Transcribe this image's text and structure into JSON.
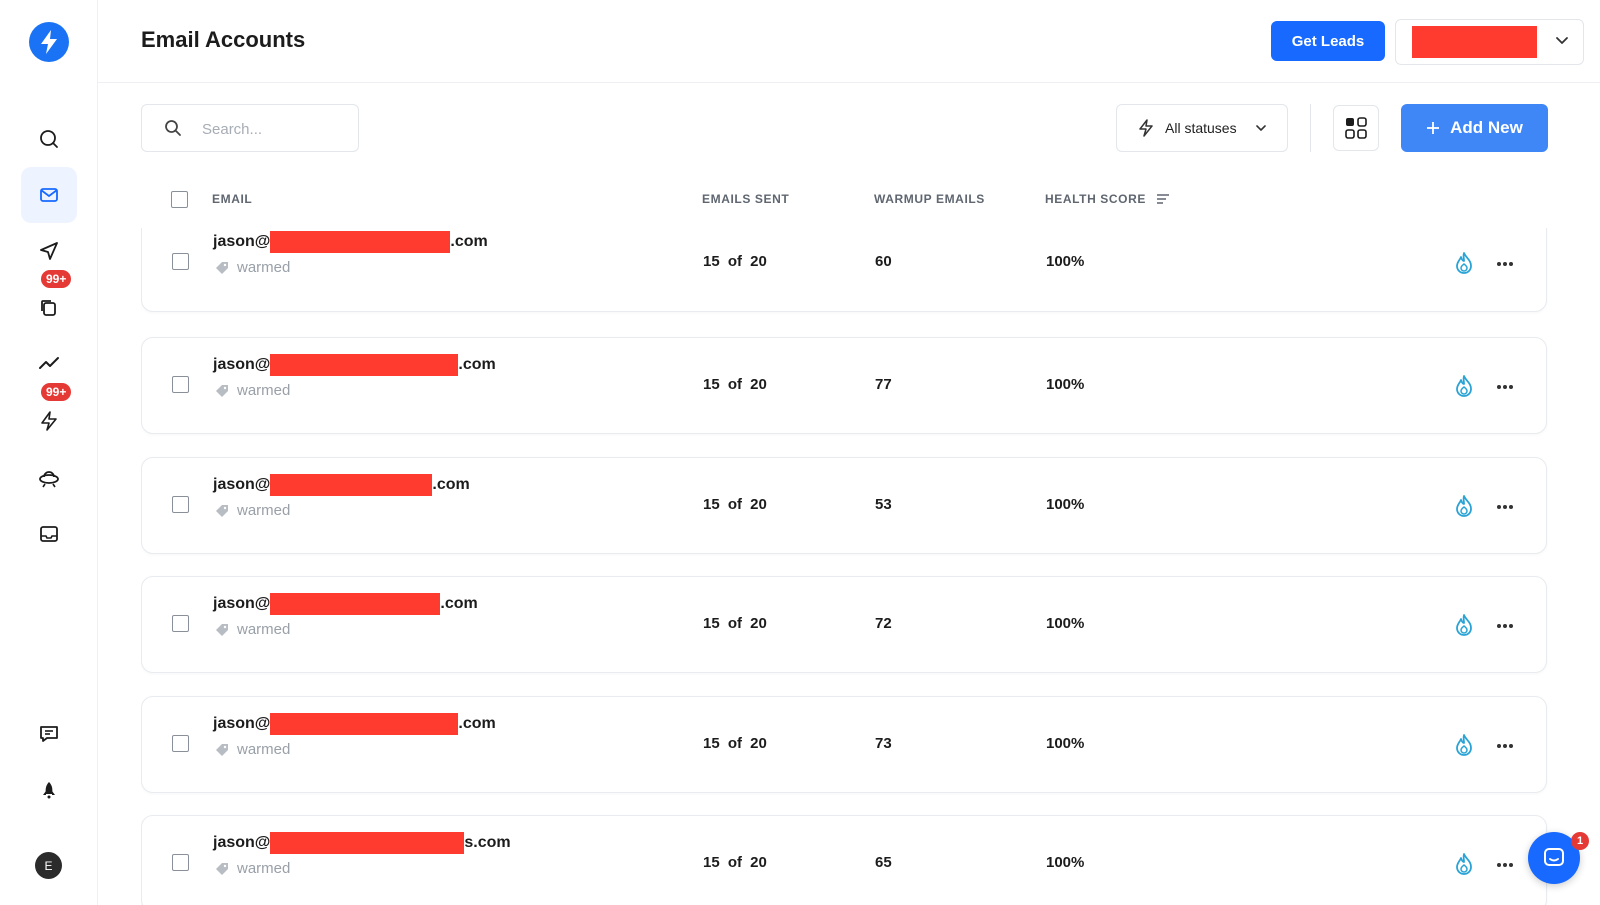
{
  "header": {
    "title": "Email Accounts",
    "get_leads_label": "Get Leads"
  },
  "sidebar": {
    "badges": {
      "item3": "99+",
      "item5": "99+"
    },
    "avatar_initial": "E"
  },
  "toolbar": {
    "search_placeholder": "Search...",
    "status_filter_label": "All statuses",
    "add_new_label": "Add New"
  },
  "table": {
    "headers": {
      "email": "EMAIL",
      "emails_sent": "EMAILS SENT",
      "warmup_emails": "WARMUP EMAILS",
      "health_score": "HEALTH SCORE"
    },
    "rows": [
      {
        "email_prefix": "jason@",
        "email_suffix": ".com",
        "tag": "warmed",
        "emails_sent": "15 of 20",
        "warmup_emails": "60",
        "health_score": "100%"
      },
      {
        "email_prefix": "jason@",
        "email_suffix": ".com",
        "tag": "warmed",
        "emails_sent": "15 of 20",
        "warmup_emails": "77",
        "health_score": "100%"
      },
      {
        "email_prefix": "jason@",
        "email_suffix": ".com",
        "tag": "warmed",
        "emails_sent": "15 of 20",
        "warmup_emails": "53",
        "health_score": "100%"
      },
      {
        "email_prefix": "jason@",
        "email_suffix": ".com",
        "tag": "warmed",
        "emails_sent": "15 of 20",
        "warmup_emails": "72",
        "health_score": "100%"
      },
      {
        "email_prefix": "jason@",
        "email_suffix": ".com",
        "tag": "warmed",
        "emails_sent": "15 of 20",
        "warmup_emails": "73",
        "health_score": "100%"
      },
      {
        "email_prefix": "jason@",
        "email_suffix": "s.com",
        "tag": "warmed",
        "emails_sent": "15 of 20",
        "warmup_emails": "65",
        "health_score": "100%"
      }
    ]
  },
  "chat": {
    "badge": "1"
  },
  "colors": {
    "primary": "#1769ff",
    "add_new": "#3f86f7",
    "redaction": "#ff3b30",
    "badge": "#e53935",
    "fire_icon": "#29a3d6"
  },
  "icons": {
    "logo": "lightning-logo-icon",
    "sidebar": [
      "search-icon",
      "mail-icon",
      "send-icon",
      "copy-icon",
      "analytics-icon",
      "zap-icon",
      "ufo-icon",
      "inbox-icon",
      "feedback-icon",
      "rocket-icon"
    ],
    "row_actions": [
      "fire-icon",
      "more-icon"
    ]
  }
}
